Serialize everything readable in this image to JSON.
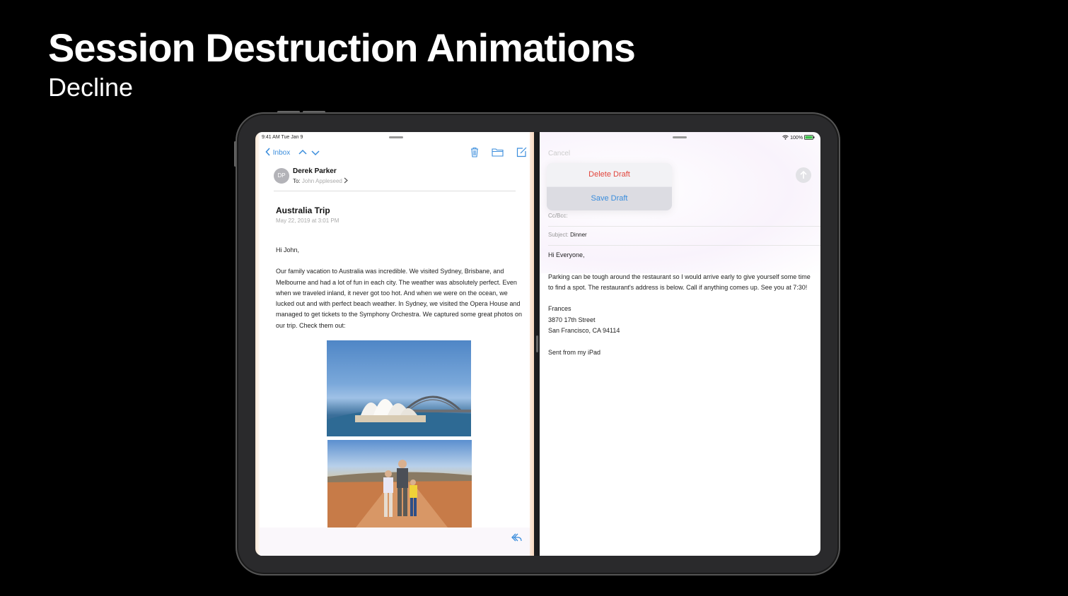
{
  "slide": {
    "title": "Session Destruction Animations",
    "subtitle": "Decline"
  },
  "left_pane": {
    "status_time": "9:41 AM  Tue Jan 9",
    "nav": {
      "back_label": "Inbox",
      "icons": [
        "chevron-left-icon",
        "chevron-up-icon",
        "chevron-down-icon",
        "trash-icon",
        "folder-icon",
        "compose-icon"
      ]
    },
    "message": {
      "avatar_initials": "DP",
      "sender": "Derek Parker",
      "to_label": "To:",
      "to_value": "John Appleseed",
      "subject": "Australia Trip",
      "date": "May 22, 2019 at 3:01 PM",
      "greeting": "Hi John,",
      "body": "Our family vacation to Australia was incredible.  We visited Sydney, Brisbane, and Melbourne and had a lot of fun in each city.  The weather was absolutely perfect.  Even when we traveled inland, it never got too hot.  And when we were on the ocean, we lucked out and with perfect beach weather.  In Sydney, we visited the Opera House and managed to get tickets to the Symphony Orchestra.  We captured some great photos on our trip.  Check them out:"
    },
    "toolbar_icon": "reply-icon"
  },
  "right_pane": {
    "status_battery": "100%",
    "cancel_label": "Cancel",
    "popover": {
      "delete_label": "Delete Draft",
      "save_label": "Save Draft"
    },
    "cc_label": "Cc/Bcc:",
    "subject_label": "Subject:",
    "subject_value": "Dinner",
    "body": {
      "greeting": "Hi Everyone,",
      "paragraph": "Parking can be tough around the restaurant so I would arrive early to give yourself some time to find a spot. The restaurant's address is below.  Call if anything comes up.  See you at 7:30!",
      "name": "Frances",
      "street": "3870 17th Street",
      "city": "San Francisco, CA 94114",
      "signature": "Sent from my iPad"
    }
  },
  "colors": {
    "accent_blue": "#3a8ddc",
    "destructive_red": "#e2453c",
    "background": "#000000"
  }
}
